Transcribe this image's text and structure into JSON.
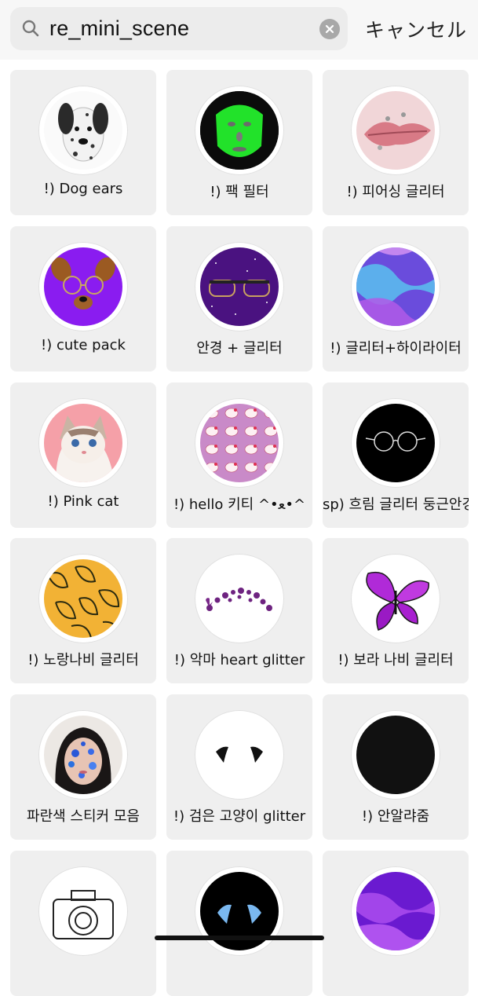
{
  "search": {
    "query": "re_mini_scene",
    "cancel_label": "キャンセル"
  },
  "results": [
    {
      "label": "!) Dog ears",
      "icon": "dalmatian-dog-icon"
    },
    {
      "label": "!) 팩 필터",
      "icon": "green-face-mask-icon"
    },
    {
      "label": "!) 피어싱 글리터",
      "icon": "pierced-lips-icon"
    },
    {
      "label": "!) cute pack",
      "icon": "dog-filter-glasses-icon"
    },
    {
      "label": "안경 +  글리터",
      "icon": "glasses-glitter-icon"
    },
    {
      "label": "!) 글리터+하이라이터",
      "icon": "holographic-swirl-icon"
    },
    {
      "label": "!) Pink cat",
      "icon": "pink-cat-icon"
    },
    {
      "label": "!) hello 키티 ^•ﻌ•^",
      "icon": "hello-kitty-pattern-icon"
    },
    {
      "label": "sp) 흐림 글리터 둥근안경",
      "icon": "round-glasses-icon"
    },
    {
      "label": "!) 노랑나비 글리터",
      "icon": "yellow-butterfly-pattern-icon"
    },
    {
      "label": "!) 악마 heart glitter",
      "icon": "heart-crown-icon"
    },
    {
      "label": "!) 보라 나비 글리터",
      "icon": "purple-butterfly-icon"
    },
    {
      "label": "파란색 스티커 모음",
      "icon": "blue-sticker-face-icon"
    },
    {
      "label": "!) 검은 고양이 glitter",
      "icon": "black-cat-ears-icon"
    },
    {
      "label": "!) 안알랴줌",
      "icon": "black-circle-icon"
    },
    {
      "label": "",
      "icon": "camera-sketch-icon"
    },
    {
      "label": "",
      "icon": "blue-ears-icon"
    },
    {
      "label": "",
      "icon": "purple-liquid-icon"
    }
  ],
  "colors": {
    "card_bg": "#efefef",
    "green_mask": "#22e22a",
    "purple": "#8a1cf0"
  }
}
